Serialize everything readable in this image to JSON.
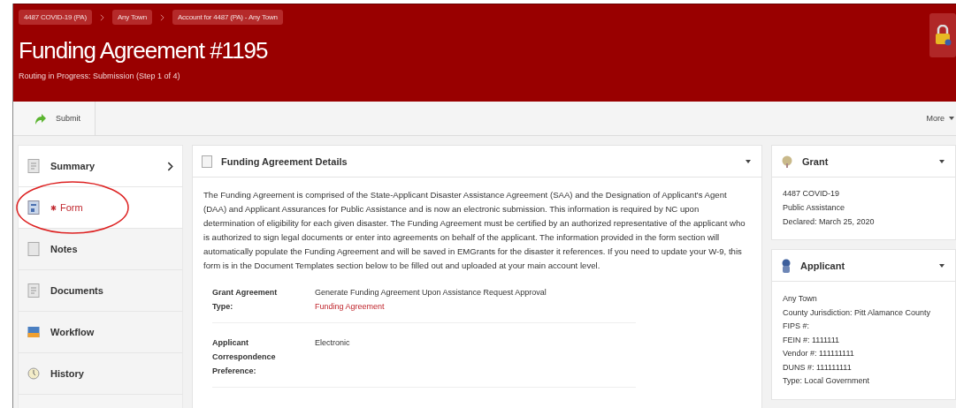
{
  "breadcrumbs": [
    "4487 COVID-19 (PA)",
    "Any Town",
    "Account for 4487 (PA) - Any Town"
  ],
  "title": "Funding Agreement #1195",
  "subtitle": "Routing in Progress: Submission (Step 1 of 4)",
  "toolbar": {
    "submit": "Submit",
    "more": "More"
  },
  "sidebar": {
    "items": [
      {
        "label": "Summary",
        "kind": "summary",
        "expandable": true,
        "required": false,
        "circled": false
      },
      {
        "label": "Form",
        "kind": "form",
        "expandable": false,
        "required": true,
        "circled": true
      },
      {
        "label": "Notes",
        "kind": "notes",
        "expandable": false,
        "required": false,
        "circled": false
      },
      {
        "label": "Documents",
        "kind": "documents",
        "expandable": false,
        "required": false,
        "circled": false
      },
      {
        "label": "Workflow",
        "kind": "workflow",
        "expandable": false,
        "required": false,
        "circled": false
      },
      {
        "label": "History",
        "kind": "history",
        "expandable": false,
        "required": false,
        "circled": false
      }
    ]
  },
  "details": {
    "title": "Funding Agreement Details",
    "description": "The Funding Agreement is comprised of the State-Applicant Disaster Assistance Agreement (SAA) and the Designation of Applicant's Agent (DAA) and Applicant Assurances for Public Assistance and is now an electronic submission. This information is required by NC upon determination of eligibility for each given disaster. The Funding Agreement must be certified by an authorized representative of the applicant who is authorized to sign legal documents or enter into agreements on behalf of the applicant. The information provided in the form section will automatically populate the Funding Agreement and will be saved in EMGrants for the disaster it references. If you need to update your W-9, this form is in the Document Templates section below to be filled out and uploaded at your main account level.",
    "fields": [
      {
        "label": "Grant Agreement Type:",
        "values": [
          {
            "text": "Generate Funding Agreement Upon Assistance Request Approval",
            "link": false
          },
          {
            "text": "Funding Agreement",
            "link": true
          }
        ]
      },
      {
        "label": "Applicant Correspondence Preference:",
        "values": [
          {
            "text": "Electronic",
            "link": false
          }
        ]
      }
    ]
  },
  "grant": {
    "title": "Grant",
    "lines": [
      "4487 COVID-19",
      "Public Assistance",
      "Declared: March 25, 2020"
    ]
  },
  "applicant": {
    "title": "Applicant",
    "lines": [
      "Any Town",
      "County Jurisdiction: Pitt Alamance County",
      "FIPS #:",
      "FEIN #: 1111111",
      "Vendor #: 111111111",
      "DUNS #: 111111111",
      "Type: Local Government"
    ]
  }
}
